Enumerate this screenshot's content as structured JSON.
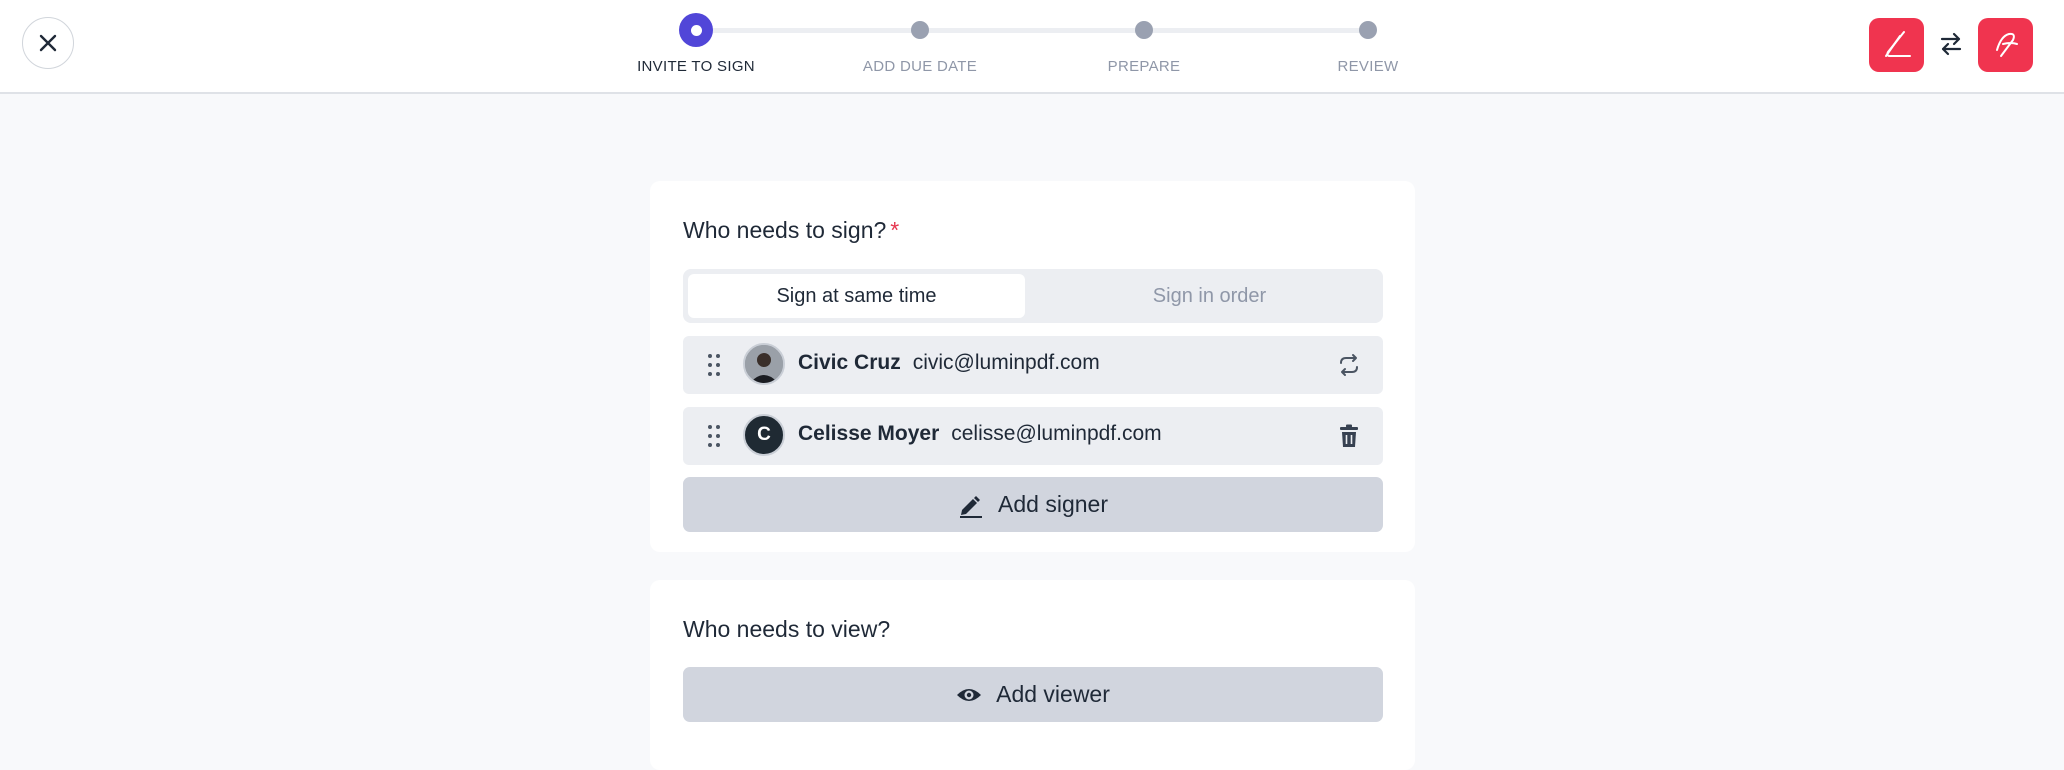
{
  "header": {
    "close_icon": "close-icon",
    "steps": [
      {
        "label": "INVITE TO SIGN",
        "state": "active"
      },
      {
        "label": "ADD DUE DATE",
        "state": "upcoming"
      },
      {
        "label": "PREPARE",
        "state": "upcoming"
      },
      {
        "label": "REVIEW",
        "state": "upcoming"
      }
    ],
    "brand_color": "#f0344f",
    "accent_color": "#5146d8",
    "right_icons": [
      "lumin-sign-logo",
      "swap-arrows-icon",
      "lumin-logo"
    ]
  },
  "signers_card": {
    "title": "Who needs to sign?",
    "required_mark": "*",
    "mode_options": {
      "selected": "Sign at same time",
      "other": "Sign in order"
    },
    "signers": [
      {
        "name": "Civic Cruz",
        "email": "civic@luminpdf.com",
        "avatar": "photo",
        "action_icon": "refresh-icon"
      },
      {
        "name": "Celisse Moyer",
        "email": "celisse@luminpdf.com",
        "avatar_letter": "C",
        "action_icon": "trash-icon"
      }
    ],
    "add_button": "Add signer"
  },
  "viewers_card": {
    "title": "Who needs to view?",
    "add_button": "Add viewer"
  }
}
